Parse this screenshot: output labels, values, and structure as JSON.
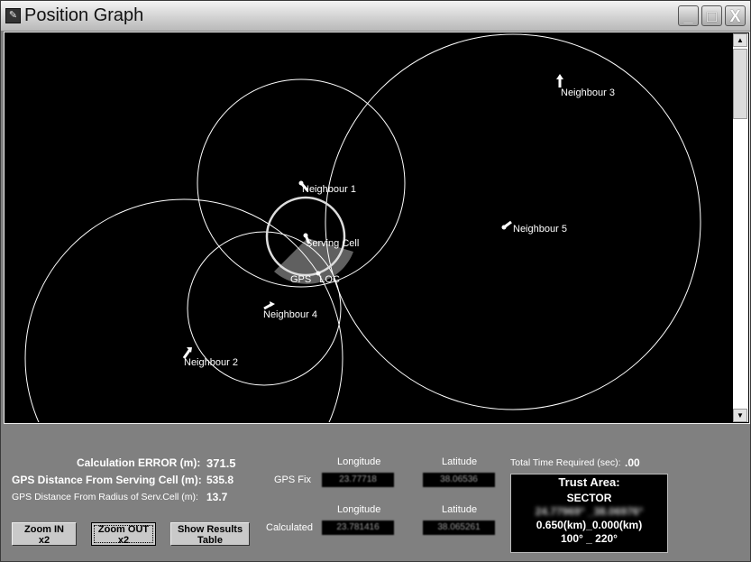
{
  "window": {
    "title": "Position Graph",
    "controls": {
      "minimize": "_",
      "maximize": "□",
      "close": "X"
    }
  },
  "graph": {
    "serving_cell": {
      "label": "Serving Cell"
    },
    "gps_loc": {
      "label": "GPS LOC"
    },
    "neighbours": [
      {
        "label": "Neighbour 1"
      },
      {
        "label": "Neighbour 2"
      },
      {
        "label": "Neighbour 3"
      },
      {
        "label": "Neighbour 4"
      },
      {
        "label": "Neighbour 5"
      }
    ],
    "sector_color": "#606060",
    "background": "#000000"
  },
  "stats": {
    "calc_error_label": "Calculation ERROR (m):",
    "calc_error_value": "371.5",
    "gps_dist_label": "GPS Distance From Serving Cell (m):",
    "gps_dist_value": "535.8",
    "gps_radius_label": "GPS Distance From Radius of Serv.Cell (m):",
    "gps_radius_value": "13.7"
  },
  "coords": {
    "longitude_header": "Longitude",
    "latitude_header": "Latitude",
    "gps_fix_label": "GPS Fix",
    "gps_fix_lon": "23.77718",
    "gps_fix_lat": "38.06536",
    "calculated_label": "Calculated",
    "calc_lon": "23.781416",
    "calc_lat": "38.065261"
  },
  "time": {
    "label": "Total Time Required (sec):",
    "value": ".00"
  },
  "trust_area": {
    "title": "Trust Area:",
    "type": "SECTOR",
    "coords": "24.77969° _38.06976°",
    "radii": "0.650(km)_0.000(km)",
    "angles": "100° _ 220°"
  },
  "buttons": {
    "zoom_in": "Zoom IN x2",
    "zoom_out": "Zoom OUT x2",
    "show_results": "Show Results Table"
  }
}
